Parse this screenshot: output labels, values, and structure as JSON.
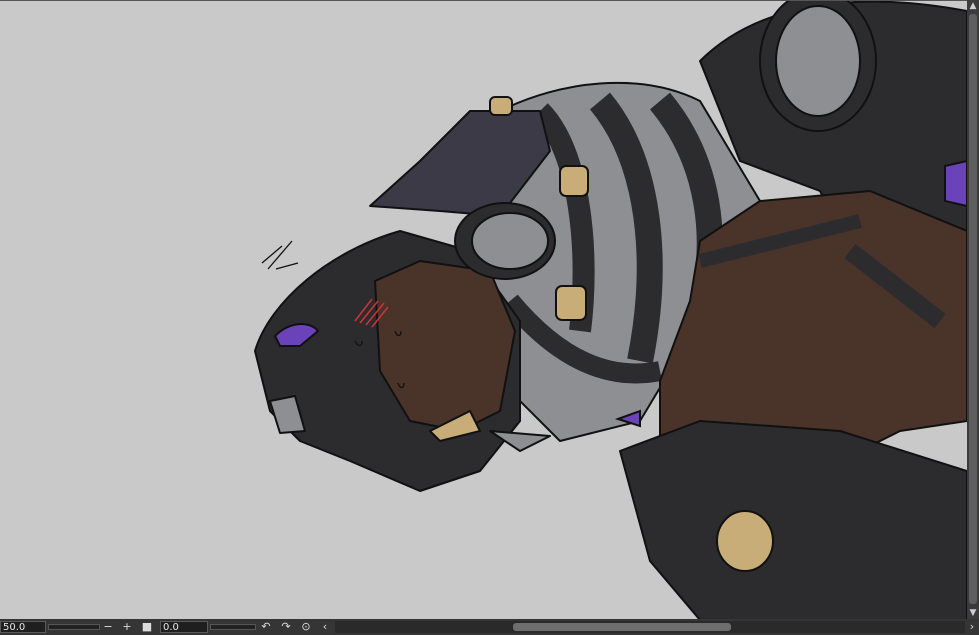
{
  "canvas": {
    "background": "#c9c9c9"
  },
  "statusbar": {
    "zoom_value": "50.0",
    "rotation_value": "0.0",
    "zoom_out_icon": "minus",
    "zoom_in_icon": "plus",
    "fit_icon": "square",
    "undo_icon": "rotate-left",
    "redo_icon": "rotate-right",
    "reset_icon": "reset-rotation",
    "scroll_left_icon": "chevron-left",
    "scroll_right_icon": "chevron-right"
  },
  "scrollbar": {
    "up_icon": "chevron-up",
    "down_icon": "chevron-down"
  },
  "colors": {
    "dark": "#2c2b2e",
    "gray": "#8e8f93",
    "brown": "#4a3329",
    "tan": "#c8ad78",
    "purple": "#6a43b8",
    "slate": "#3d3a47"
  }
}
